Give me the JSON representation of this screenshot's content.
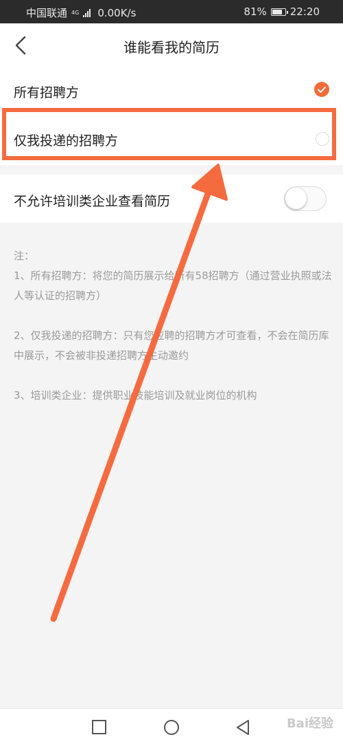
{
  "status_bar": {
    "carrier": "中国联通",
    "network_tag": "4G",
    "speed": "0.00K/s",
    "battery_percent": "81%",
    "battery_level": 0.81,
    "time": "22:20"
  },
  "header": {
    "title": "谁能看我的简历",
    "back_icon": "chevron-left-icon"
  },
  "options": [
    {
      "label": "所有招聘方",
      "selected": true
    },
    {
      "label": "仅我投递的招聘方",
      "selected": false
    }
  ],
  "toggle_row": {
    "label": "不允许培训类企业查看简历",
    "enabled": false
  },
  "notes": {
    "heading": "注：",
    "item1": "1、所有招聘方：将您的简历展示给所有58招聘方（通过营业执照或法人等认证的招聘方）",
    "item2": "2、仅我投递的招聘方：只有您应聘的招聘方才可查看，不会在简历库中展示，不会被非投递招聘方主动邀约",
    "item3": "3、培训类企业：提供职业技能培训及就业岗位的机构"
  },
  "colors": {
    "accent": "#f26b3a",
    "annotation": "#f56b40"
  },
  "nav": {
    "recent_icon": "square-icon",
    "home_icon": "circle-icon",
    "back_icon": "triangle-back-icon"
  },
  "watermark": "Bai经验"
}
